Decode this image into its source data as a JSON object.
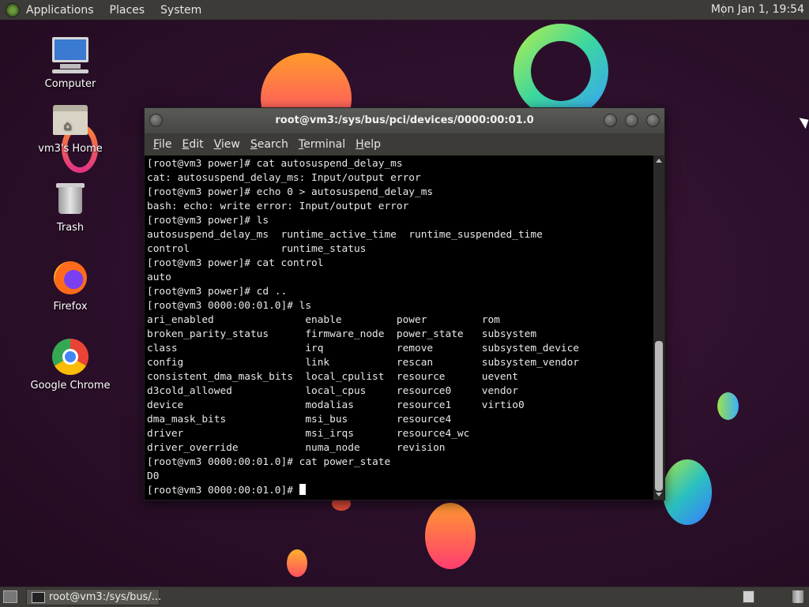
{
  "top_panel": {
    "menus": [
      "Applications",
      "Places",
      "System"
    ],
    "clock": "Mon Jan  1, 19:54"
  },
  "desktop_icons": [
    {
      "label": "Computer",
      "icon": "computer-icon"
    },
    {
      "label": "vm3's Home",
      "icon": "home-folder-icon"
    },
    {
      "label": "Trash",
      "icon": "trash-icon"
    },
    {
      "label": "Firefox",
      "icon": "firefox-icon"
    },
    {
      "label": "Google Chrome",
      "icon": "chrome-icon"
    }
  ],
  "terminal": {
    "title": "root@vm3:/sys/bus/pci/devices/0000:00:01.0",
    "menu": [
      "File",
      "Edit",
      "View",
      "Search",
      "Terminal",
      "Help"
    ],
    "lines": [
      "[root@vm3 power]# cat autosuspend_delay_ms",
      "cat: autosuspend_delay_ms: Input/output error",
      "[root@vm3 power]# echo 0 > autosuspend_delay_ms",
      "bash: echo: write error: Input/output error",
      "[root@vm3 power]# ls",
      "autosuspend_delay_ms  runtime_active_time  runtime_suspended_time",
      "control               runtime_status",
      "[root@vm3 power]# cat control",
      "auto",
      "[root@vm3 power]# cd ..",
      "[root@vm3 0000:00:01.0]# ls",
      "ari_enabled               enable         power         rom",
      "broken_parity_status      firmware_node  power_state   subsystem",
      "class                     irq            remove        subsystem_device",
      "config                    link           rescan        subsystem_vendor",
      "consistent_dma_mask_bits  local_cpulist  resource      uevent",
      "d3cold_allowed            local_cpus     resource0     vendor",
      "device                    modalias       resource1     virtio0",
      "dma_mask_bits             msi_bus        resource4",
      "driver                    msi_irqs       resource4_wc",
      "driver_override           numa_node      revision",
      "[root@vm3 0000:00:01.0]# cat power_state",
      "D0"
    ],
    "prompt": "[root@vm3 0000:00:01.0]# "
  },
  "taskbar": {
    "task_label": "root@vm3:/sys/bus/..."
  }
}
